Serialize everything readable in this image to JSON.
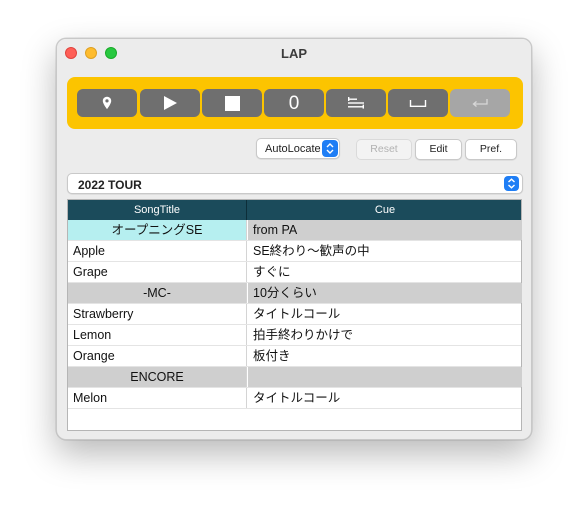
{
  "window": {
    "title": "LAP"
  },
  "transport": {
    "counter": "0",
    "buttons": [
      {
        "name": "locate",
        "icon": "location-pin-icon",
        "enabled": true
      },
      {
        "name": "play",
        "icon": "play-icon",
        "enabled": true
      },
      {
        "name": "stop",
        "icon": "stop-icon",
        "enabled": true
      },
      {
        "name": "counter",
        "enabled": true
      },
      {
        "name": "list",
        "icon": "list-icon",
        "enabled": true
      },
      {
        "name": "space",
        "icon": "space-key-icon",
        "enabled": true
      },
      {
        "name": "return",
        "icon": "return-key-icon",
        "enabled": false
      }
    ],
    "color": "#fcc400"
  },
  "controls": {
    "autolocate_label": "AutoLocate",
    "reset_label": "Reset",
    "edit_label": "Edit",
    "pref_label": "Pref."
  },
  "tour": {
    "selected": "2022 TOUR"
  },
  "table": {
    "headers": [
      "SongTitle",
      "Cue"
    ],
    "rows": [
      {
        "title": "オープニングSE",
        "cue": "from PA",
        "type": "current"
      },
      {
        "title": "Apple",
        "cue": "SE終わり〜歓声の中",
        "type": "song"
      },
      {
        "title": "Grape",
        "cue": "すぐに",
        "type": "song"
      },
      {
        "title": "-MC-",
        "cue": "10分くらい",
        "type": "section"
      },
      {
        "title": "Strawberry",
        "cue": "タイトルコール",
        "type": "song"
      },
      {
        "title": "Lemon",
        "cue": "拍手終わりかけで",
        "type": "song"
      },
      {
        "title": "Orange",
        "cue": "板付き",
        "type": "song"
      },
      {
        "title": "ENCORE",
        "cue": "",
        "type": "section"
      },
      {
        "title": "Melon",
        "cue": "タイトルコール",
        "type": "song"
      }
    ]
  },
  "colors": {
    "header_bg": "#1b4b5b",
    "current_row": "#b6eff0",
    "section_row": "#cfcfcf",
    "popup_accent": "#1f7ef5"
  }
}
